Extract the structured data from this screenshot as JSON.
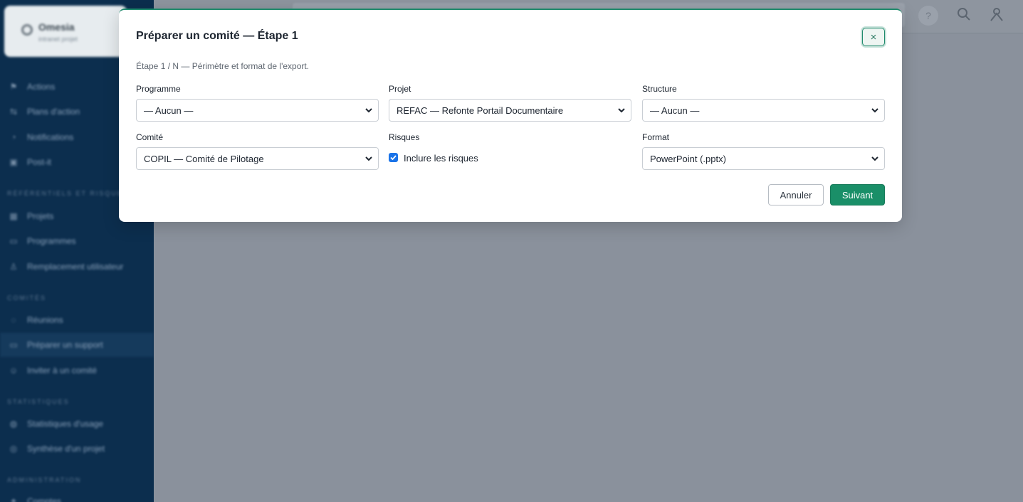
{
  "sidebar": {
    "brand_name": "Omesia",
    "brand_sub": "intranet projet",
    "sections": [
      "Référentiels et risques",
      "Comités",
      "Statistiques",
      "Administration"
    ],
    "items": [
      {
        "label": "Actions",
        "icon": "flag-icon"
      },
      {
        "label": "Plans d'action",
        "icon": "link-icon"
      },
      {
        "label": "Notifications",
        "icon": "bell-icon"
      },
      {
        "label": "Post-it",
        "icon": "note-icon"
      },
      {
        "label": "Projets",
        "icon": "grid-icon"
      },
      {
        "label": "Programmes",
        "icon": "folder-icon"
      },
      {
        "label": "Remplacement utilisateur",
        "icon": "user-icon"
      },
      {
        "label": "Réunions",
        "icon": "chat-icon"
      },
      {
        "label": "Préparer un support",
        "icon": "folder-icon"
      },
      {
        "label": "Inviter à un comité",
        "icon": "users-icon"
      },
      {
        "label": "Statistiques d'usage",
        "icon": "stats-icon"
      },
      {
        "label": "Synthèse d'un projet",
        "icon": "target-icon"
      },
      {
        "label": "Comptes",
        "icon": "account-icon"
      }
    ]
  },
  "topbar": {
    "help_label": "?"
  },
  "modal": {
    "title": "Préparer un comité — Étape 1",
    "close_label": "×",
    "subtitle": "Étape 1 / N — Périmètre et format de l'export.",
    "fields": {
      "programme": {
        "label": "Programme",
        "value": "— Aucun —"
      },
      "projet": {
        "label": "Projet",
        "value": "REFAC — Refonte Portail Documentaire"
      },
      "structure": {
        "label": "Structure",
        "value": "— Aucun —"
      },
      "comite": {
        "label": "Comité",
        "value": "COPIL — Comité de Pilotage"
      },
      "risques": {
        "label": "Risques",
        "checkbox_label": "Inclure les risques",
        "checked": true
      },
      "format": {
        "label": "Format",
        "value": "PowerPoint (.pptx)"
      }
    },
    "buttons": {
      "cancel": "Annuler",
      "next": "Suivant"
    }
  },
  "colors": {
    "accent": "#1a8f68",
    "sidebar_bg": "#0c2e4e",
    "overlay": "#8a919c",
    "checkbox": "#1a73e8"
  }
}
